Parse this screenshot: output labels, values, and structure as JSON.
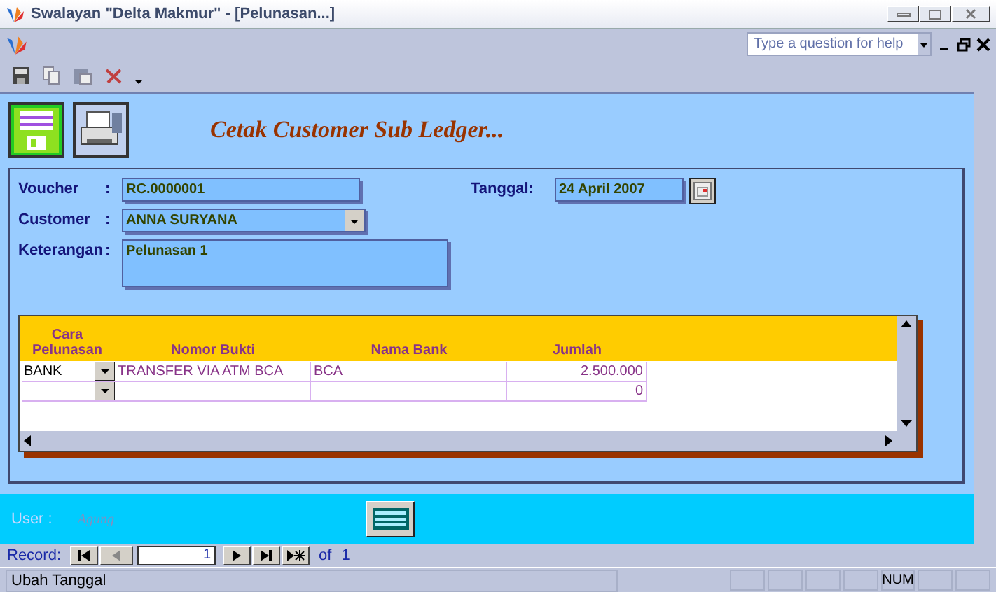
{
  "window": {
    "title": "Swalayan \"Delta Makmur\" - [Pelunasan...]"
  },
  "help": {
    "placeholder": "Type a question for help"
  },
  "form_title": "Cetak Customer Sub Ledger...",
  "fields": [
    {
      "label": "Voucher",
      "colon": ":",
      "value": "RC.0000001"
    },
    {
      "label": "Customer",
      "colon": ":",
      "value": "ANNA SURYANA"
    },
    {
      "label": "Keterangan",
      "colon": ":",
      "value": "Pelunasan 1"
    }
  ],
  "tanggal": {
    "label": "Tanggal:",
    "value": "24 April 2007"
  },
  "table": {
    "columns": [
      "Cara Pelunasan",
      "Nomor Bukti",
      "Nama Bank",
      "Jumlah"
    ],
    "rows": [
      [
        "BANK",
        "TRANSFER VIA ATM BCA",
        "BCA",
        "2.500.000"
      ],
      [
        "",
        "",
        "",
        "0"
      ]
    ]
  },
  "user": {
    "label": "User :",
    "value": "Agung"
  },
  "record_nav": {
    "label": "Record:",
    "current": "1",
    "of": "of",
    "total": "1"
  },
  "status_bar": {
    "text": "Ubah Tanggal",
    "num": "NUM"
  }
}
